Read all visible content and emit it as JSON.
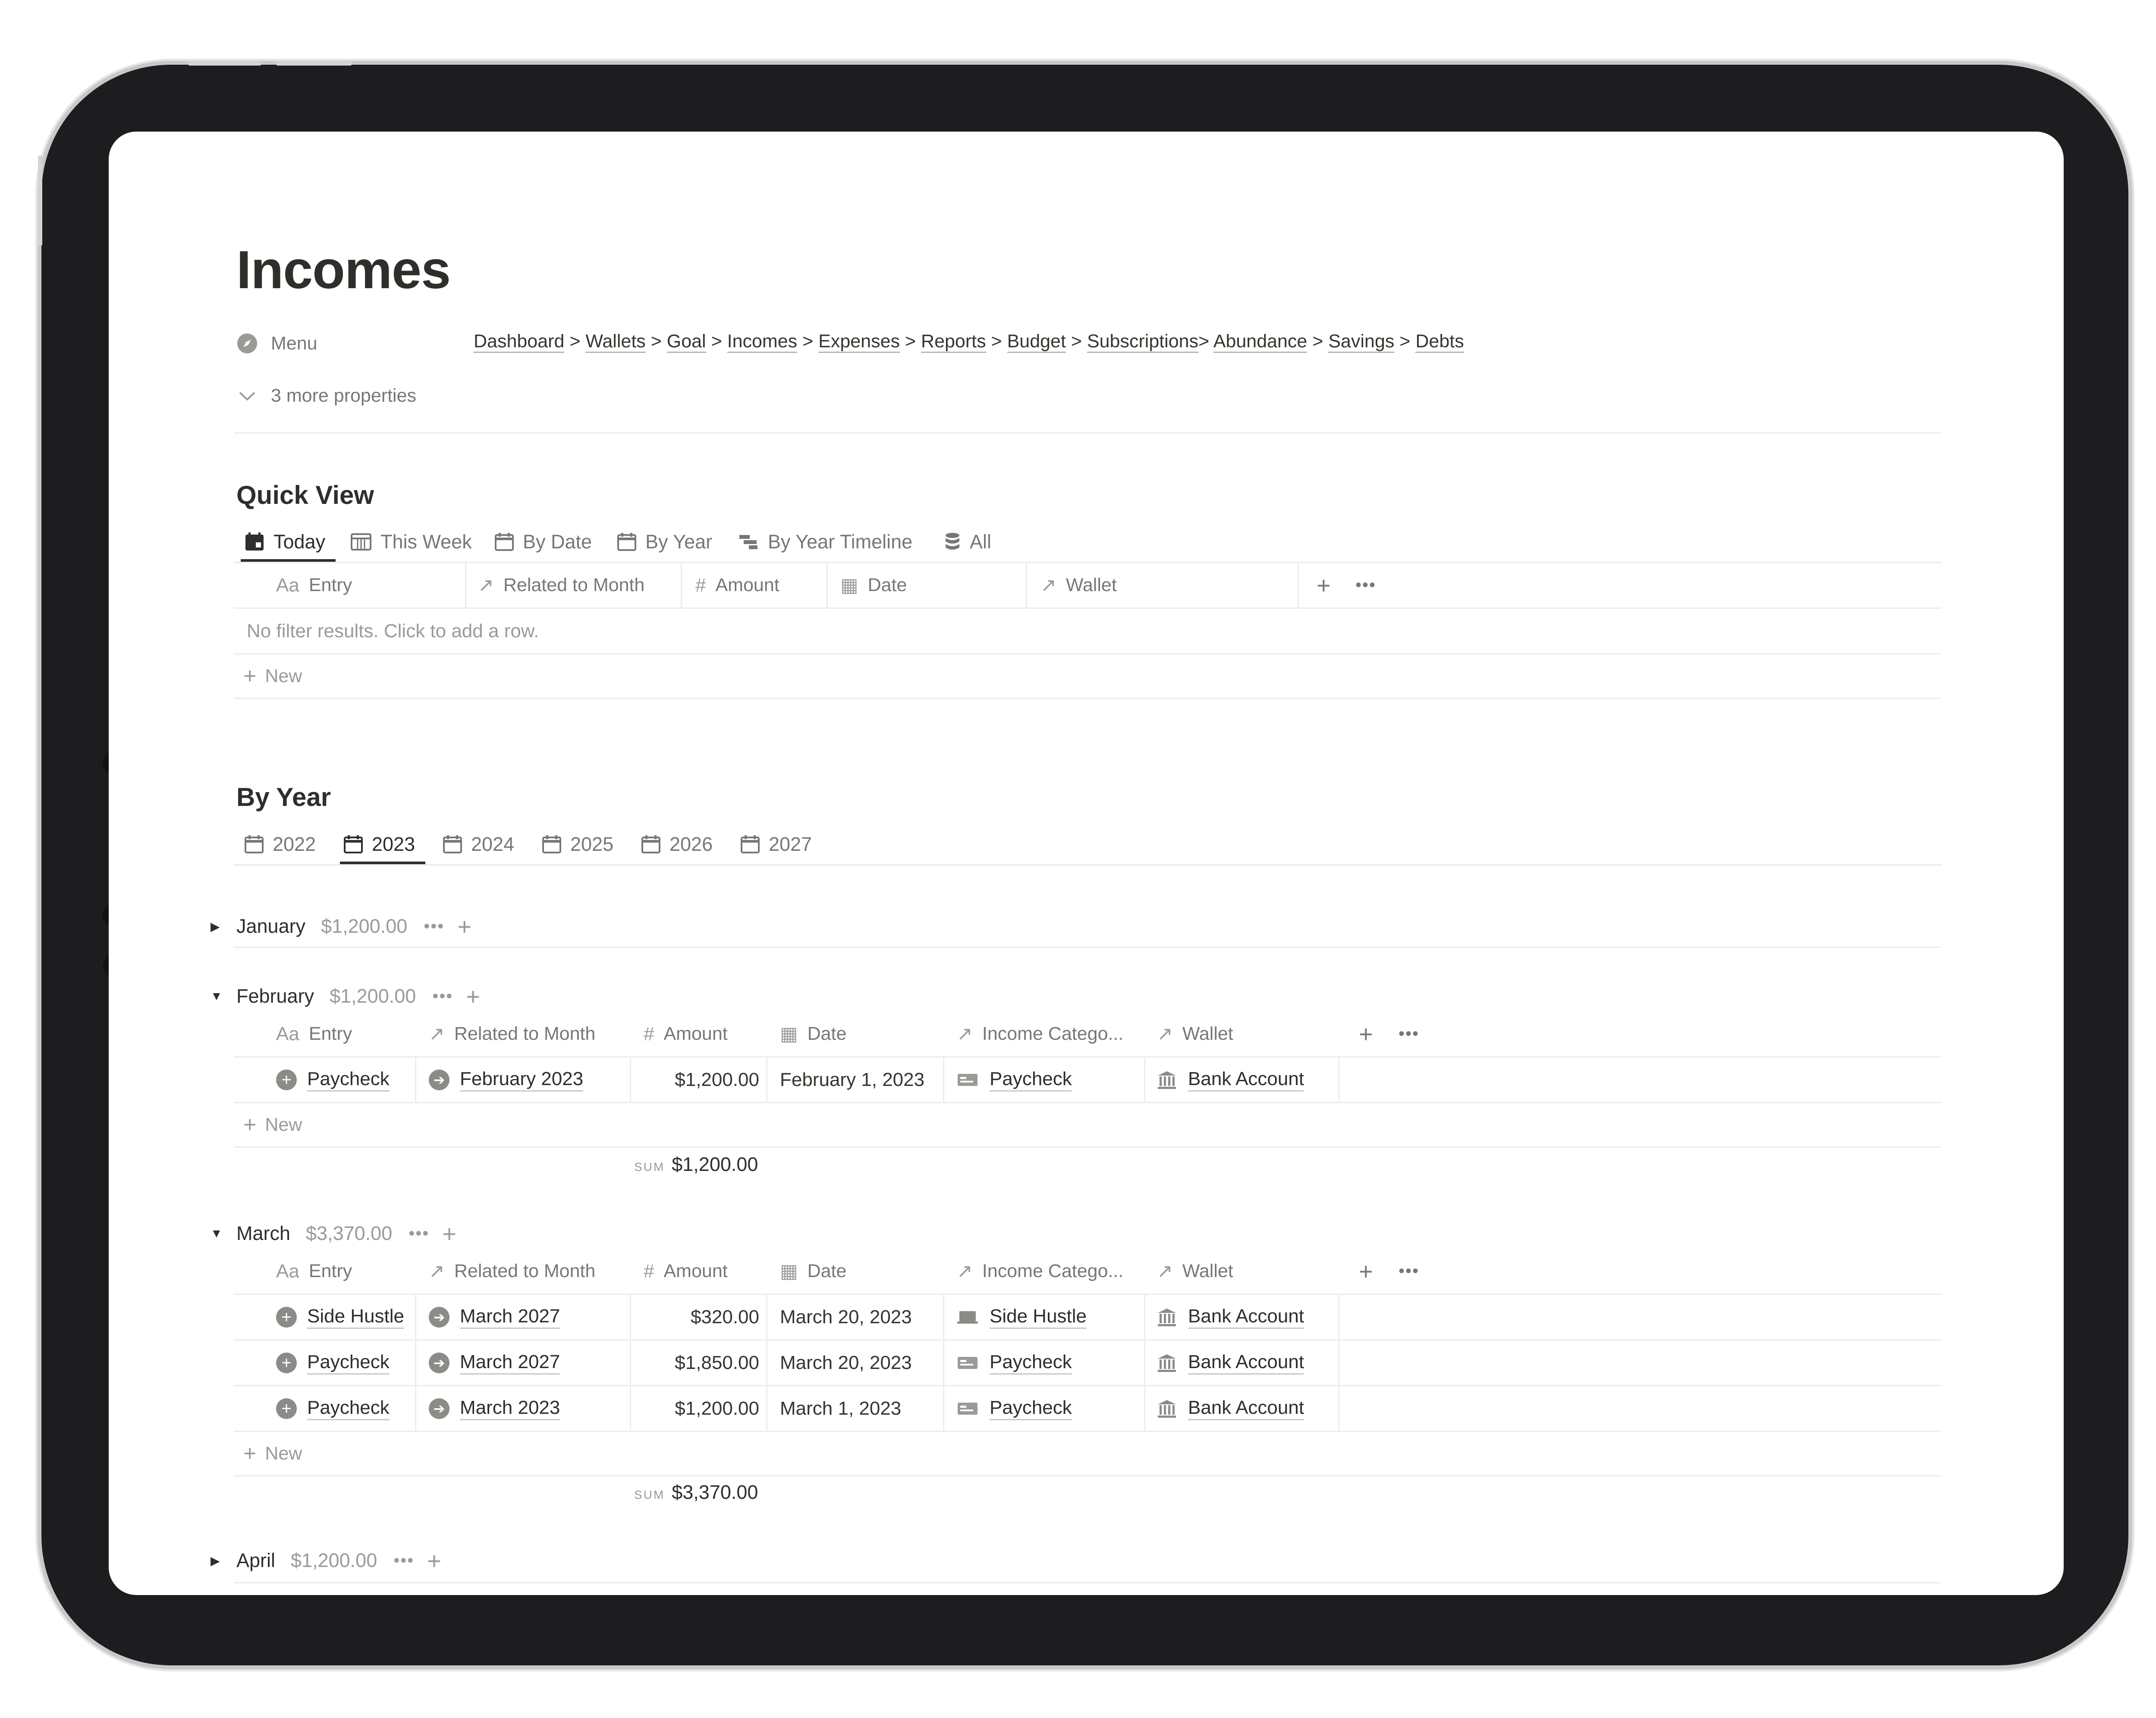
{
  "page": {
    "title": "Incomes",
    "menu_label": "Menu",
    "more_properties": "3 more properties",
    "nav_links": [
      "Dashboard",
      "Wallets",
      "Goal",
      "Incomes",
      "Expenses",
      "Reports",
      "Budget",
      "Subscriptions",
      "Abundance",
      "Savings",
      "Debts"
    ],
    "nav_separators": [
      " > ",
      " > ",
      " > ",
      " > ",
      " > ",
      " > ",
      " > ",
      "> ",
      " > ",
      " > "
    ]
  },
  "quick_view": {
    "heading": "Quick View",
    "tabs": [
      "Today",
      "This Week",
      "By Date",
      "By Year",
      "By Year Timeline",
      "All"
    ],
    "active_tab": "Today",
    "columns": [
      "Entry",
      "Related to Month",
      "Amount",
      "Date",
      "Wallet"
    ],
    "empty_text": "No filter results. Click to add a row.",
    "new_label": "New"
  },
  "by_year": {
    "heading": "By Year",
    "tabs": [
      "2022",
      "2023",
      "2024",
      "2025",
      "2026",
      "2027"
    ],
    "active_tab": "2023",
    "columns": [
      "Entry",
      "Related to Month",
      "Amount",
      "Date",
      "Income Catego...",
      "Wallet"
    ],
    "new_label": "New",
    "sum_label": "SUM",
    "groups": [
      {
        "name": "January",
        "total": "$1,200.00",
        "expanded": false,
        "rows": []
      },
      {
        "name": "February",
        "total": "$1,200.00",
        "expanded": true,
        "sum": "$1,200.00",
        "rows": [
          {
            "entry": "Paycheck",
            "month": "February 2023",
            "amount": "$1,200.00",
            "date": "February 1, 2023",
            "category": "Paycheck",
            "wallet": "Bank Account"
          }
        ]
      },
      {
        "name": "March",
        "total": "$3,370.00",
        "expanded": true,
        "sum": "$3,370.00",
        "rows": [
          {
            "entry": "Side Hustle",
            "month": "March 2027",
            "amount": "$320.00",
            "date": "March 20, 2023",
            "category": "Side Hustle",
            "wallet": "Bank Account"
          },
          {
            "entry": "Paycheck",
            "month": "March 2027",
            "amount": "$1,850.00",
            "date": "March 20, 2023",
            "category": "Paycheck",
            "wallet": "Bank Account"
          },
          {
            "entry": "Paycheck",
            "month": "March 2023",
            "amount": "$1,200.00",
            "date": "March 1, 2023",
            "category": "Paycheck",
            "wallet": "Bank Account"
          }
        ]
      },
      {
        "name": "April",
        "total": "$1,200.00",
        "expanded": false,
        "rows": []
      }
    ]
  },
  "colors": {
    "text": "#37352f",
    "muted": "#787774",
    "divider": "#ececea",
    "bezel": "#1d1d1f"
  }
}
